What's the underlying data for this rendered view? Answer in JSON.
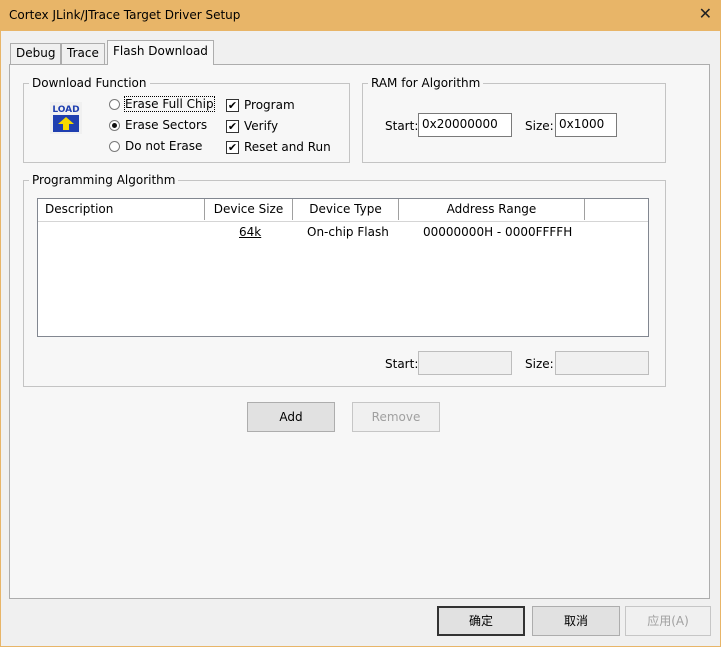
{
  "window": {
    "title": "Cortex JLink/JTrace Target Driver Setup"
  },
  "tabs": [
    {
      "label": "Debug",
      "active": false
    },
    {
      "label": "Trace",
      "active": false
    },
    {
      "label": "Flash Download",
      "active": true
    }
  ],
  "download_function": {
    "legend": "Download Function",
    "icon_label": "LOAD",
    "radios": [
      {
        "label": "Erase Full Chip",
        "checked": false
      },
      {
        "label": "Erase Sectors",
        "checked": true
      },
      {
        "label": "Do not Erase",
        "checked": false
      }
    ],
    "checkboxes": [
      {
        "label": "Program",
        "checked": true
      },
      {
        "label": "Verify",
        "checked": true
      },
      {
        "label": "Reset and Run",
        "checked": true
      }
    ]
  },
  "ram_for_algorithm": {
    "legend": "RAM for Algorithm",
    "start_label": "Start:",
    "start_value": "0x20000000",
    "size_label": "Size:",
    "size_value": "0x1000"
  },
  "programming_algorithm": {
    "legend": "Programming Algorithm",
    "columns": [
      "Description",
      "Device Size",
      "Device Type",
      "Address Range"
    ],
    "rows": [
      {
        "description": "",
        "device_size": "64k",
        "device_type": "On-chip Flash",
        "address_range": "00000000H - 0000FFFFH"
      }
    ],
    "start_label": "Start:",
    "start_value": "",
    "size_label": "Size:",
    "size_value": ""
  },
  "buttons": {
    "add": "Add",
    "remove": "Remove"
  },
  "dialog_buttons": {
    "ok": "确定",
    "cancel": "取消",
    "apply": "应用(A)"
  },
  "colors": {
    "titlebar": "#e8b568",
    "icon_blue": "#1f3fb0",
    "icon_yellow": "#f5d800"
  }
}
